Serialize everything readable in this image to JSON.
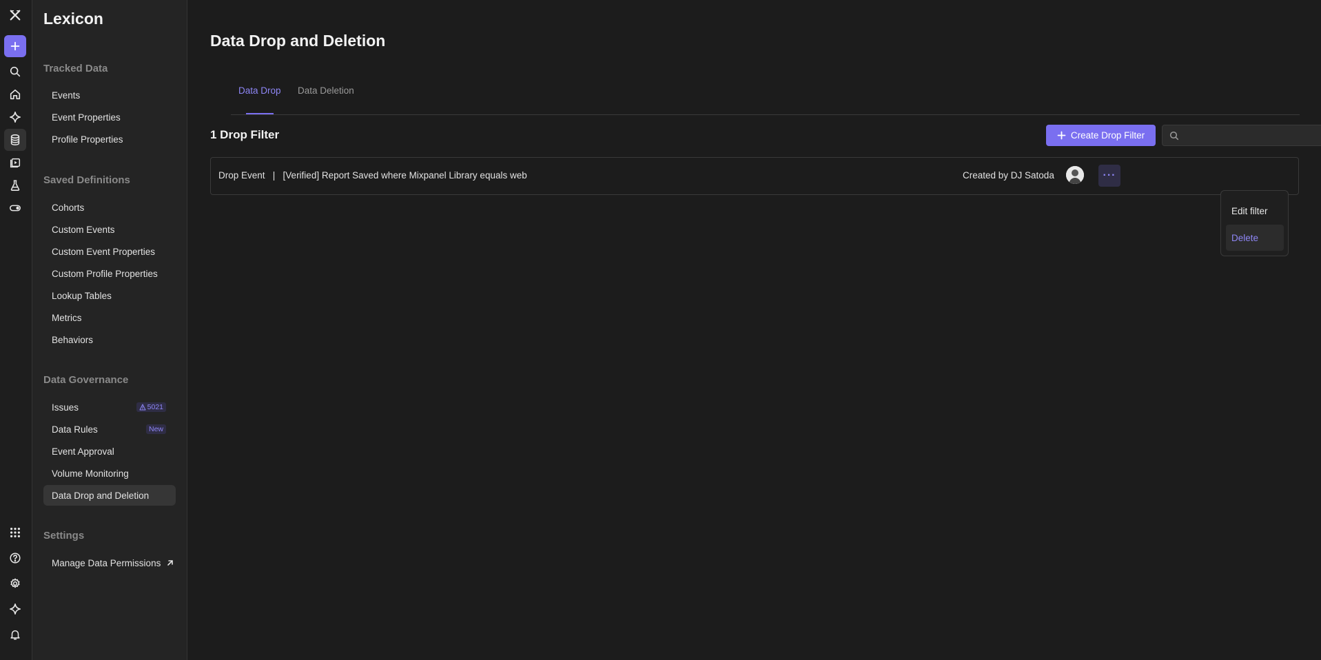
{
  "rail": {
    "items": [
      {
        "name": "logo-icon"
      },
      {
        "name": "add-icon"
      },
      {
        "name": "search-icon"
      },
      {
        "name": "home-icon"
      },
      {
        "name": "sparkle-icon"
      },
      {
        "name": "database-icon"
      },
      {
        "name": "play-icon"
      },
      {
        "name": "flask-icon"
      },
      {
        "name": "toggle-icon"
      },
      {
        "name": "apps-grid-icon"
      },
      {
        "name": "help-icon"
      },
      {
        "name": "gear-icon"
      },
      {
        "name": "sparkle-icon"
      },
      {
        "name": "bell-icon"
      }
    ]
  },
  "sidebar": {
    "title": "Lexicon",
    "sections": {
      "tracked": "Tracked Data",
      "saved": "Saved Definitions",
      "governance": "Data Governance",
      "settings": "Settings"
    },
    "items": {
      "events": "Events",
      "event_properties": "Event Properties",
      "profile_properties": "Profile Properties",
      "cohorts": "Cohorts",
      "custom_events": "Custom Events",
      "custom_event_properties": "Custom Event Properties",
      "custom_profile_properties": "Custom Profile Properties",
      "lookup_tables": "Lookup Tables",
      "metrics": "Metrics",
      "behaviors": "Behaviors",
      "issues": "Issues",
      "issues_badge": "5021",
      "data_rules": "Data Rules",
      "data_rules_badge": "New",
      "event_approval": "Event Approval",
      "volume_monitoring": "Volume Monitoring",
      "data_drop": "Data Drop and Deletion",
      "manage_permissions": "Manage Data Permissions"
    }
  },
  "main": {
    "title": "Data Drop and Deletion",
    "tabs": [
      "Data Drop",
      "Data Deletion"
    ],
    "count_label": "1 Drop Filter",
    "create_label": "Create Drop Filter",
    "search": {
      "value": "",
      "placeholder": ""
    },
    "filters": [
      {
        "description": "Drop Event   |   [Verified] Report Saved where Mixpanel Library equals web",
        "creator": "Created by DJ Satoda"
      }
    ],
    "menu": {
      "edit": "Edit filter",
      "delete": "Delete"
    }
  },
  "colors": {
    "accent": "#7a6ff0",
    "accent_text": "#8e86f5",
    "background": "#1c1c1c",
    "sidebar": "#242424"
  }
}
